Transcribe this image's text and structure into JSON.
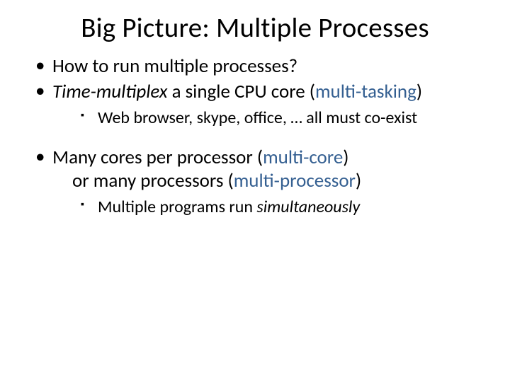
{
  "title": "Big Picture: Multiple Processes",
  "b1": "How to run multiple processes?",
  "b2a": "Time-multiplex",
  "b2b": " a single CPU core (",
  "b2c": "multi-tasking",
  "b2d": ")",
  "s1a": "Web browser, skype, office, … all must co-exist",
  "b3a": "Many cores per processor (",
  "b3b": "multi-core",
  "b3c": ")",
  "b3d": "or many processors (",
  "b3e": "multi-processor",
  "b3f": ")",
  "s2a": "Multiple programs run ",
  "s2b": "simultaneously"
}
